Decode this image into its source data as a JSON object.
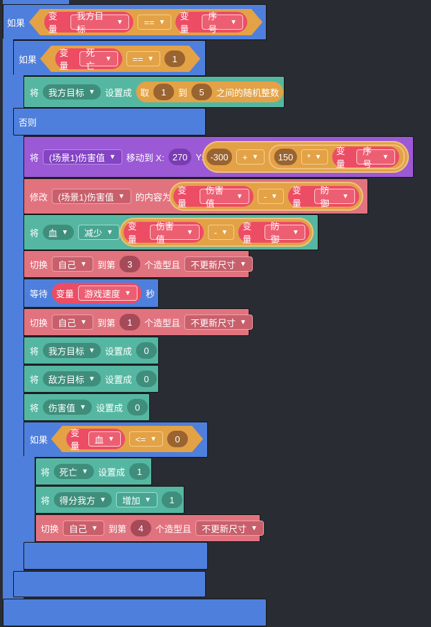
{
  "labels": {
    "if": "如果",
    "else": "否则",
    "set_prefix": "将",
    "set_to": "设置成",
    "var": "变量",
    "random_take": "取",
    "random_to": "到",
    "random_suffix": "之间的随机整数",
    "move_to_x": "移动到 X:",
    "y": "Y:",
    "modify": "修改",
    "content_is": "的内容为",
    "switch": "切换",
    "to_nth": "到第",
    "costume_and": "个造型且",
    "wait": "等待",
    "seconds": "秒"
  },
  "outer_if": {
    "left_var": "我方目标",
    "op": "==",
    "right_var": "序号"
  },
  "inner_if": {
    "var": "死亡",
    "op": "==",
    "value": "1"
  },
  "set_target": {
    "var": "我方目标",
    "from": "1",
    "to": "5"
  },
  "move_block": {
    "sprite": "(场景1)伤害值",
    "x": "270",
    "neg": "-300",
    "plus": "+",
    "mult_a": "150",
    "times": "*",
    "var": "序号"
  },
  "modify_block": {
    "sprite": "(场景1)伤害值",
    "var_a": "伤害值",
    "op": "-",
    "var_b": "防御"
  },
  "hp_block": {
    "var": "血",
    "action": "减少",
    "var_a": "伤害值",
    "op": "-",
    "var_b": "防御"
  },
  "switch1": {
    "target": "自己",
    "n": "3",
    "mode": "不更新尺寸"
  },
  "wait_block": {
    "var": "游戏速度"
  },
  "switch2": {
    "target": "自己",
    "n": "1",
    "mode": "不更新尺寸"
  },
  "reset1": {
    "var": "我方目标",
    "value": "0"
  },
  "reset2": {
    "var": "敌方目标",
    "value": "0"
  },
  "reset3": {
    "var": "伤害值",
    "value": "0"
  },
  "nested_if": {
    "var": "血",
    "op": "<=",
    "value": "0"
  },
  "death_set": {
    "var": "死亡",
    "value": "1"
  },
  "score_block": {
    "var": "得分我方",
    "action": "增加",
    "value": "1"
  },
  "switch3": {
    "target": "自己",
    "n": "4",
    "mode": "不更新尺寸"
  }
}
